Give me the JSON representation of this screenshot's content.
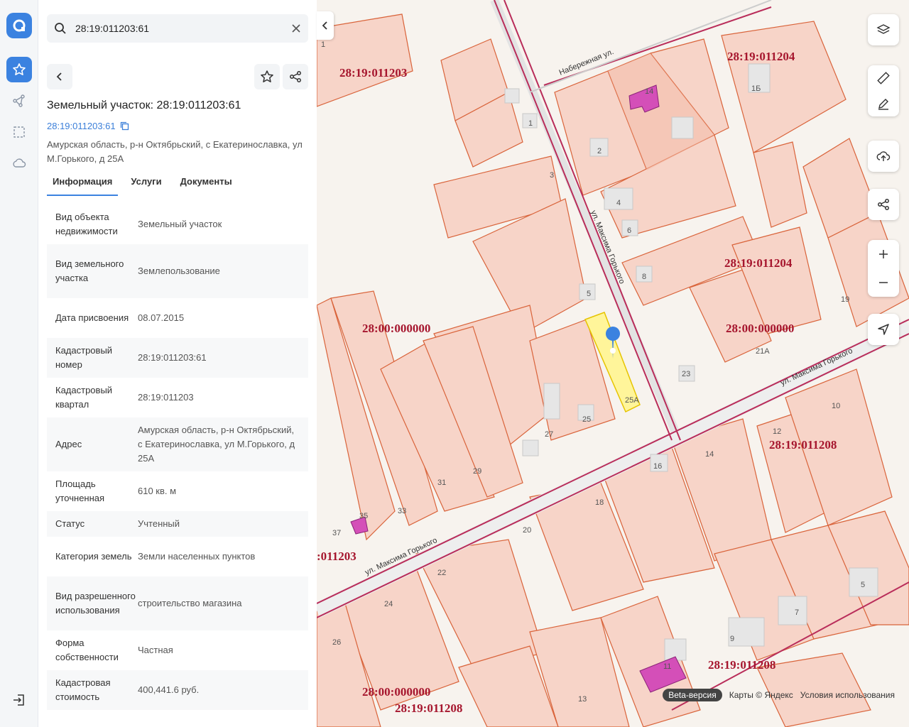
{
  "search": {
    "value": "28:19:011203:61"
  },
  "header": {
    "title": "Земельный участок: 28:19:011203:61",
    "cad_link": "28:19:011203:61",
    "address": "Амурская область, р-н Октябрьский, с Екатеринославка, ул М.Горького, д 25А"
  },
  "tabs": [
    "Информация",
    "Услуги",
    "Документы"
  ],
  "info": [
    {
      "key": "Вид объекта недвижимости",
      "value": "Земельный участок"
    },
    {
      "key": "Вид земельного участка",
      "value": "Землепользование"
    },
    {
      "key": "Дата присвоения",
      "value": "08.07.2015"
    },
    {
      "key": "Кадастровый номер",
      "value": "28:19:011203:61"
    },
    {
      "key": "Кадастровый квартал",
      "value": "28:19:011203"
    },
    {
      "key": "Адрес",
      "value": "Амурская область, р-н Октябрьский, с Екатеринославка, ул М.Горького, д 25А"
    },
    {
      "key": "Площадь уточненная",
      "value": "610 кв. м"
    },
    {
      "key": "Статус",
      "value": "Учтенный"
    },
    {
      "key": "Категория земель",
      "value": "Земли населенных пунктов"
    },
    {
      "key": "Вид разрешенного использования",
      "value": "строительство магазина"
    },
    {
      "key": "Форма собственности",
      "value": "Частная"
    },
    {
      "key": "Кадастровая стоимость",
      "value": "400,441.6 руб."
    }
  ],
  "map": {
    "quarters": [
      "28:19:011203",
      "28:19:011204",
      "28:19:011204",
      "28:00:000000",
      "28:00:000000",
      "28:19:011208",
      ":011203",
      "28:19:011208",
      "28:00:000000",
      "28:19:011208"
    ],
    "streets": [
      "Набережная ул.",
      "ул. Максима Горького",
      "ул. Максима Горького",
      "ул. Максима Горького"
    ],
    "house_numbers": [
      "1",
      "1",
      "2",
      "3",
      "4",
      "5",
      "6",
      "8",
      "14",
      "1Б",
      "19",
      "21А",
      "23",
      "25",
      "25А",
      "27",
      "29",
      "31",
      "33",
      "35",
      "37",
      "10",
      "12",
      "14",
      "16",
      "18",
      "20",
      "22",
      "24",
      "26",
      "13",
      "11",
      "9",
      "7",
      "5"
    ],
    "footer": {
      "beta": "Beta-версия",
      "maps": "Карты © Яндекс",
      "terms": "Условия использования"
    }
  }
}
